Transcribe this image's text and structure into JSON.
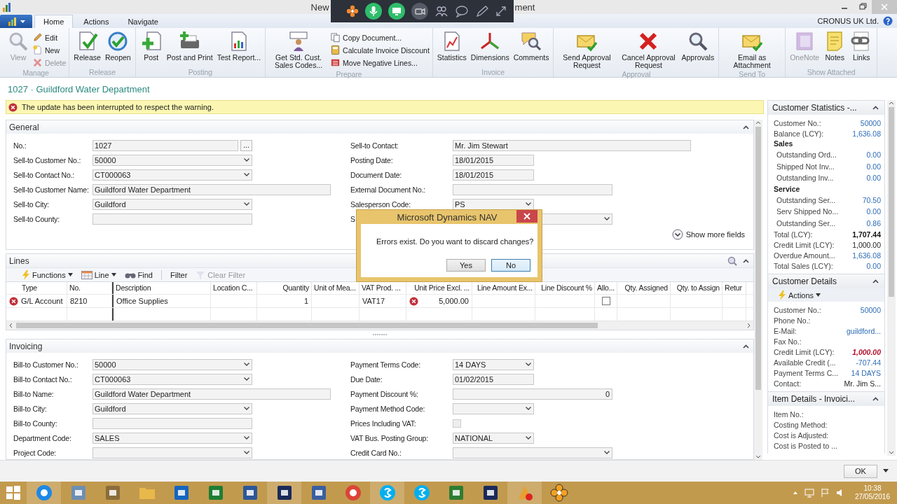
{
  "window": {
    "title_start": "New",
    "title_end": "ment"
  },
  "tabs": [
    {
      "label": "Home",
      "selected": true
    },
    {
      "label": "Actions",
      "selected": false
    },
    {
      "label": "Navigate",
      "selected": false
    }
  ],
  "company": "CRONUS UK Ltd.",
  "ribbon": [
    {
      "label": "Manage",
      "buttons": [
        {
          "label": "View",
          "kind": "large",
          "disabled": true
        },
        {
          "label": "Edit",
          "kind": "small",
          "disabled": false
        },
        {
          "label": "New",
          "kind": "small",
          "disabled": false
        },
        {
          "label": "Delete",
          "kind": "small",
          "disabled": true
        }
      ]
    },
    {
      "label": "Release",
      "buttons": [
        {
          "label": "Release",
          "kind": "large",
          "disabled": false
        },
        {
          "label": "Reopen",
          "kind": "large",
          "disabled": false
        }
      ]
    },
    {
      "label": "Posting",
      "buttons": [
        {
          "label": "Post",
          "kind": "large",
          "disabled": false
        },
        {
          "label": "Post and Print",
          "kind": "large",
          "disabled": false
        },
        {
          "label": "Test Report...",
          "kind": "large",
          "disabled": false
        }
      ]
    },
    {
      "label": "Prepare",
      "buttons": [
        {
          "label": "Get Std. Cust. Sales Codes...",
          "kind": "large",
          "disabled": false
        },
        {
          "label": "Copy Document...",
          "kind": "small",
          "disabled": false
        },
        {
          "label": "Calculate Invoice Discount",
          "kind": "small",
          "disabled": false
        },
        {
          "label": "Move Negative Lines...",
          "kind": "small",
          "disabled": false
        }
      ]
    },
    {
      "label": "Invoice",
      "buttons": [
        {
          "label": "Statistics",
          "kind": "large",
          "disabled": false
        },
        {
          "label": "Dimensions",
          "kind": "large",
          "disabled": false
        },
        {
          "label": "Comments",
          "kind": "large",
          "disabled": false
        }
      ]
    },
    {
      "label": "Approval",
      "buttons": [
        {
          "label": "Send Approval Request",
          "kind": "large",
          "disabled": false
        },
        {
          "label": "Cancel Approval Request",
          "kind": "large",
          "disabled": false
        },
        {
          "label": "Approvals",
          "kind": "large",
          "disabled": false
        }
      ]
    },
    {
      "label": "Send To",
      "buttons": [
        {
          "label": "Email as Attachment",
          "kind": "large",
          "disabled": false
        }
      ]
    },
    {
      "label": "Show Attached",
      "buttons": [
        {
          "label": "OneNote",
          "kind": "large",
          "disabled": true
        },
        {
          "label": "Notes",
          "kind": "large",
          "disabled": false
        },
        {
          "label": "Links",
          "kind": "large",
          "disabled": false
        }
      ]
    }
  ],
  "page_title": "1027 · Guildford Water Department",
  "warning": "The update has been interrupted to respect the warning.",
  "general": {
    "title": "General",
    "expanded": true,
    "left": [
      {
        "label": "No.:",
        "value": "1027",
        "kind": "lookup",
        "button": "..."
      },
      {
        "label": "Sell-to Customer No.:",
        "value": "50000",
        "kind": "dropdown"
      },
      {
        "label": "Sell-to Contact No.:",
        "value": "CT000063",
        "kind": "dropdown"
      },
      {
        "label": "Sell-to Customer Name:",
        "value": "Guildford Water Department",
        "kind": "longtext"
      },
      {
        "label": "Sell-to City:",
        "value": "Guildford",
        "kind": "dropdown"
      },
      {
        "label": "Sell-to County:",
        "kind": "text"
      }
    ],
    "right": [
      {
        "label": "Sell-to Contact:",
        "value": "Mr. Jim Stewart",
        "kind": "widetext"
      },
      {
        "label": "Posting Date:",
        "value": "18/01/2015",
        "kind": "date"
      },
      {
        "label": "Document Date:",
        "value": "18/01/2015",
        "kind": "date"
      },
      {
        "label": "External Document No.:",
        "kind": "text"
      },
      {
        "label": "Salesperson Code:",
        "value": "PS",
        "kind": "code"
      },
      {
        "label": "S",
        "kind": "dropdown"
      }
    ],
    "more_fields": "Show more fields"
  },
  "lines": {
    "title": "Lines",
    "expanded": true,
    "toolbar": [
      {
        "label": "Functions",
        "kind": "menu",
        "disabled": false
      },
      {
        "label": "Line",
        "kind": "menu",
        "disabled": false
      },
      {
        "label": "Find",
        "kind": "find",
        "disabled": false
      },
      {
        "label": "Filter",
        "kind": "plain",
        "disabled": false
      },
      {
        "label": "Clear Filter",
        "kind": "clear",
        "disabled": true
      }
    ],
    "columns": [
      {
        "label": "Type",
        "kind": "text"
      },
      {
        "label": "No.",
        "kind": "text"
      },
      {
        "label": "Description",
        "kind": "text"
      },
      {
        "label": "Location C...",
        "kind": "text"
      },
      {
        "label": "Quantity",
        "kind": "number"
      },
      {
        "label": "Unit of Mea...",
        "kind": "text"
      },
      {
        "label": "VAT Prod. ...",
        "kind": "text"
      },
      {
        "label": "Unit Price Excl. ...",
        "kind": "number"
      },
      {
        "label": "Line Amount Ex...",
        "kind": "number"
      },
      {
        "label": "Line Discount %",
        "kind": "number"
      },
      {
        "label": "Allo...",
        "kind": "text"
      },
      {
        "label": "Qty. Assigned",
        "kind": "number"
      },
      {
        "label": "Qty. to Assign",
        "kind": "number"
      },
      {
        "label": "Retur",
        "kind": "text"
      }
    ],
    "rows": [
      {
        "error": true,
        "cells": [
          {
            "text": "G/L Account"
          },
          {
            "text": "8210"
          },
          {
            "text": "Office Supplies"
          },
          {},
          {
            "text": "1"
          },
          {},
          {
            "text": "VAT17"
          },
          {
            "text": "5,000.00",
            "error": true
          },
          {},
          {},
          {
            "kind": "checkbox",
            "checked": false
          },
          {},
          {},
          {}
        ]
      },
      {
        "error": false,
        "cells": []
      }
    ]
  },
  "invoicing": {
    "title": "Invoicing",
    "expanded": true,
    "left": [
      {
        "label": "Bill-to Customer No.:",
        "value": "50000",
        "kind": "dropdown"
      },
      {
        "label": "Bill-to Contact No.:",
        "value": "CT000063",
        "kind": "dropdown"
      },
      {
        "label": "Bill-to Name:",
        "value": "Guildford Water Department",
        "kind": "longtext"
      },
      {
        "label": "Bill-to City:",
        "value": "Guildford",
        "kind": "dropdown"
      },
      {
        "label": "Bill-to County:",
        "kind": "text"
      },
      {
        "label": "Department Code:",
        "value": "SALES",
        "kind": "dropdown"
      },
      {
        "label": "Project Code:",
        "kind": "dropdown"
      }
    ],
    "right": [
      {
        "label": "Payment Terms Code:",
        "value": "14 DAYS",
        "kind": "code"
      },
      {
        "label": "Due Date:",
        "value": "01/02/2015",
        "kind": "date"
      },
      {
        "label": "Payment Discount %:",
        "value": "0",
        "kind": "number"
      },
      {
        "label": "Payment Method Code:",
        "kind": "code"
      },
      {
        "label": "Prices Including VAT:",
        "kind": "checkbox",
        "checked": false,
        "disabled": true
      },
      {
        "label": "VAT Bus. Posting Group:",
        "value": "NATIONAL",
        "kind": "code"
      },
      {
        "label": "Credit Card No.:",
        "kind": "dropdown"
      }
    ]
  },
  "factboxes": [
    {
      "title": "Customer Statistics -...",
      "expanded": true,
      "rows": [
        {
          "kind": "field",
          "label": "Customer No.:",
          "value": "50000",
          "link": true,
          "bold": false,
          "alert": false
        },
        {
          "kind": "field",
          "label": "Balance (LCY):",
          "value": "1,636.08",
          "link": true,
          "bold": false,
          "alert": false
        },
        {
          "kind": "group",
          "label": "Sales",
          "children": [
            {
              "kind": "field",
              "label": "Outstanding Ord...",
              "value": "0.00",
              "link": true,
              "bold": false,
              "alert": false
            },
            {
              "kind": "field",
              "label": "Shipped Not Inv...",
              "value": "0.00",
              "link": true,
              "bold": false,
              "alert": false
            },
            {
              "kind": "field",
              "label": "Outstanding Inv...",
              "value": "0.00",
              "link": true,
              "bold": false,
              "alert": false
            }
          ]
        },
        {
          "kind": "group",
          "label": "Service",
          "children": [
            {
              "kind": "field",
              "label": "Outstanding Ser...",
              "value": "70.50",
              "link": true,
              "bold": false,
              "alert": false
            },
            {
              "kind": "field",
              "label": "Serv Shipped No...",
              "value": "0.00",
              "link": true,
              "bold": false,
              "alert": false
            },
            {
              "kind": "field",
              "label": "Outstanding Ser...",
              "value": "0.86",
              "link": true,
              "bold": false,
              "alert": false
            }
          ]
        },
        {
          "kind": "field",
          "label": "Total (LCY):",
          "value": "1,707.44",
          "link": false,
          "bold": true,
          "alert": false
        },
        {
          "kind": "field",
          "label": "Credit Limit (LCY):",
          "value": "1,000.00",
          "link": false,
          "bold": false,
          "alert": false
        },
        {
          "kind": "field",
          "label": "Overdue Amount...",
          "value": "1,636.08",
          "link": true,
          "bold": false,
          "alert": false
        },
        {
          "kind": "field",
          "label": "Total Sales (LCY):",
          "value": "0.00",
          "link": true,
          "bold": false,
          "alert": false
        }
      ]
    },
    {
      "title": "Customer Details",
      "expanded": true,
      "actions": "Actions",
      "rows": [
        {
          "kind": "field",
          "label": "Customer No.:",
          "value": "50000",
          "link": true,
          "bold": false,
          "alert": false
        },
        {
          "kind": "field",
          "label": "Phone No.:"
        },
        {
          "kind": "field",
          "label": "E-Mail:",
          "value": "guildford...",
          "link": true,
          "bold": false,
          "alert": false
        },
        {
          "kind": "field",
          "label": "Fax No.:"
        },
        {
          "kind": "field",
          "label": "Credit Limit (LCY):",
          "value": "1,000.00",
          "link": false,
          "bold": true,
          "alert": true
        },
        {
          "kind": "field",
          "label": "Available Credit (...",
          "value": "-707.44",
          "link": true,
          "bold": false,
          "alert": false
        },
        {
          "kind": "field",
          "label": "Payment Terms C...",
          "value": "14 DAYS",
          "link": true,
          "bold": false,
          "alert": false
        },
        {
          "kind": "field",
          "label": "Contact:",
          "value": "Mr. Jim S...",
          "link": false,
          "bold": false,
          "alert": false
        }
      ]
    },
    {
      "title": "Item Details - Invoici...",
      "expanded": true,
      "rows": [
        {
          "kind": "field",
          "label": "Item No.:"
        },
        {
          "kind": "field",
          "label": "Costing Method:"
        },
        {
          "kind": "field",
          "label": "Cost is Adjusted:"
        },
        {
          "kind": "field",
          "label": "Cost is Posted to ..."
        }
      ]
    }
  ],
  "dialog": {
    "title": "Microsoft Dynamics NAV",
    "message": "Errors exist. Do you want to discard changes?",
    "buttons": [
      {
        "label": "Yes",
        "selected": false
      },
      {
        "label": "No",
        "selected": true
      }
    ]
  },
  "ok_button": "OK",
  "taskbar": {
    "time": "10:38",
    "date": "27/05/2016"
  }
}
